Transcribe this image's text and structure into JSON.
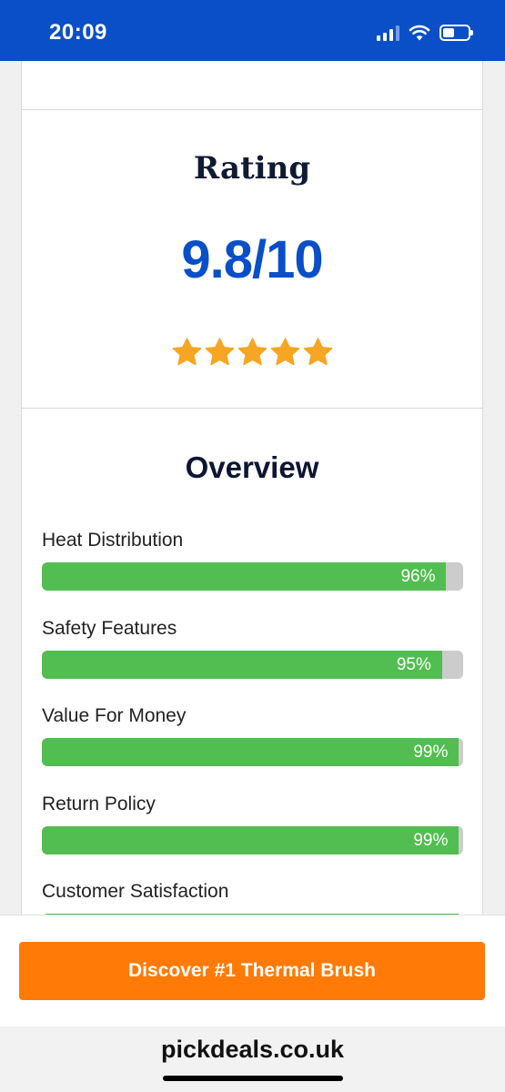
{
  "status_bar": {
    "time": "20:09",
    "signal_bars_filled": 3,
    "signal_bars_total": 4,
    "battery_level": 0.45
  },
  "rating": {
    "title": "Rating",
    "score": "9.8/10",
    "stars": 5,
    "star_color": "#f6a623"
  },
  "overview": {
    "title": "Overview",
    "items": [
      {
        "label": "Heat Distribution",
        "percent": 96,
        "percent_label": "96%"
      },
      {
        "label": "Safety Features",
        "percent": 95,
        "percent_label": "95%"
      },
      {
        "label": "Value For Money",
        "percent": 99,
        "percent_label": "99%"
      },
      {
        "label": "Return Policy",
        "percent": 99,
        "percent_label": "99%"
      },
      {
        "label": "Customer Satisfaction",
        "percent": 99,
        "percent_label": ""
      }
    ],
    "bar_color": "#52bd50",
    "track_color": "#cccccc"
  },
  "cta": {
    "label": "Discover #1 Thermal Brush",
    "color": "#ff7a06"
  },
  "browser": {
    "url": "pickdeals.co.uk"
  },
  "theme": {
    "accent": "#0a4fc7"
  }
}
